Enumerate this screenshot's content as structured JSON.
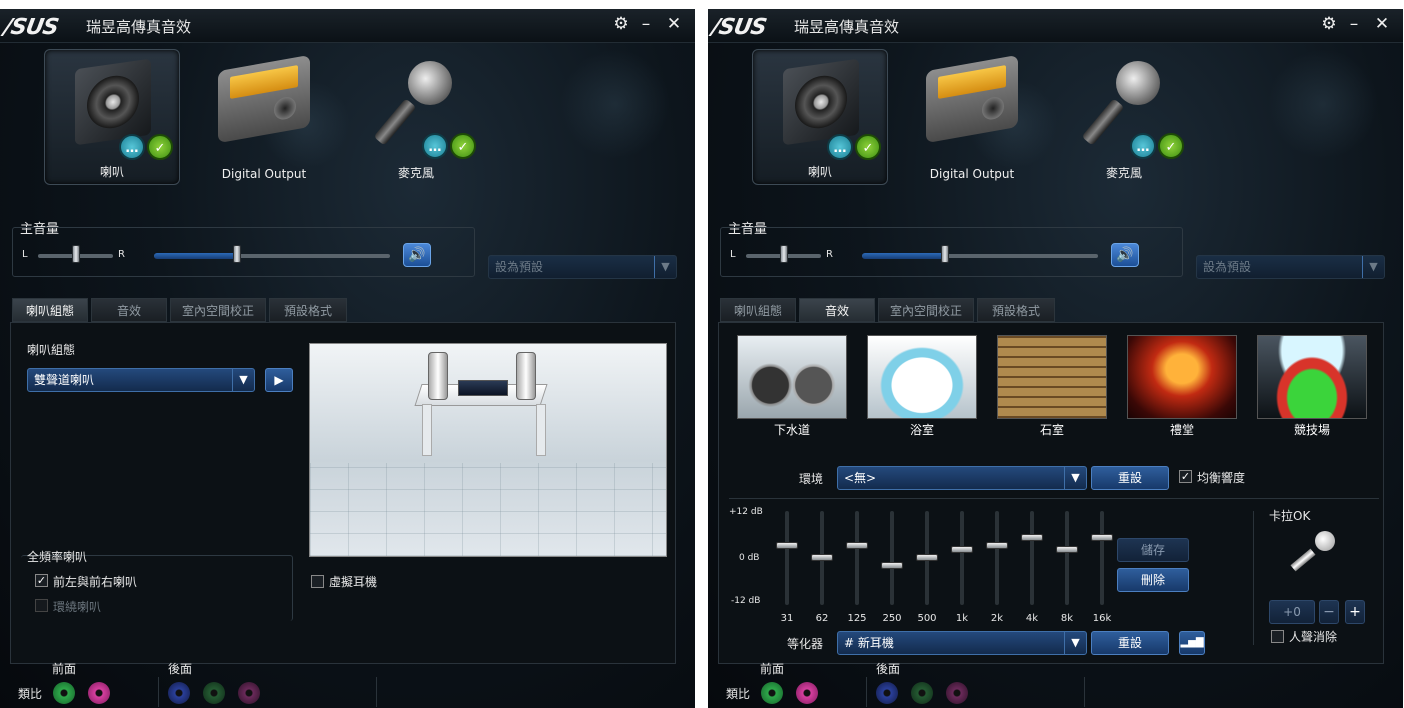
{
  "windows": [
    {
      "brand": "/SUS",
      "title": "瑞昱高傳真音效",
      "devices": [
        {
          "label": "喇叭",
          "icon": "speaker-icon",
          "selected": true
        },
        {
          "label": "Digital Output",
          "icon": "digital-output-icon",
          "selected": false
        },
        {
          "label": "麥克風",
          "icon": "microphone-icon",
          "selected": false
        }
      ],
      "volume": {
        "title": "主音量",
        "left": "L",
        "right": "R",
        "level": 0.35,
        "balance": 0.5
      },
      "default_device": "設為預設",
      "tabs": [
        "喇叭組態",
        "音效",
        "室內空間校正",
        "預設格式"
      ],
      "active_tab": 0,
      "config": {
        "title": "喇叭組態",
        "mode": "雙聲道喇叭",
        "fullrange_title": "全頻率喇叭",
        "front_label": "前左與前右喇叭",
        "front_checked": true,
        "surround_label": "環繞喇叭",
        "virtual_label": "虛擬耳機"
      },
      "jacks": {
        "front": "前面",
        "rear": "後面",
        "analog": "類比"
      }
    },
    {
      "brand": "/SUS",
      "title": "瑞昱高傳真音效",
      "devices": [
        {
          "label": "喇叭",
          "icon": "speaker-icon",
          "selected": true
        },
        {
          "label": "Digital Output",
          "icon": "digital-output-icon",
          "selected": false
        },
        {
          "label": "麥克風",
          "icon": "microphone-icon",
          "selected": false
        }
      ],
      "volume": {
        "title": "主音量",
        "left": "L",
        "right": "R",
        "level": 0.35,
        "balance": 0.5
      },
      "default_device": "設為預設",
      "tabs": [
        "喇叭組態",
        "音效",
        "室內空間校正",
        "預設格式"
      ],
      "active_tab": 1,
      "effects": {
        "presets": [
          "下水道",
          "浴室",
          "石室",
          "禮堂",
          "競技場"
        ],
        "environment_label": "環境",
        "environment_value": "<無>",
        "reset": "重設",
        "loudness_label": "均衡響度",
        "loudness_checked": true,
        "db_labels": [
          "+12 dB",
          "0 dB",
          "-12 dB"
        ],
        "eq_freqs": [
          "31",
          "62",
          "125",
          "250",
          "500",
          "1k",
          "2k",
          "4k",
          "8k",
          "16k"
        ],
        "eq_values": [
          3,
          0,
          3,
          -2,
          0,
          2,
          3,
          5,
          2,
          5
        ],
        "save": "儲存",
        "delete": "刪除",
        "eq_label": "等化器",
        "eq_preset": "# 新耳機",
        "karaoke_title": "卡拉OK",
        "karaoke_value": "+0",
        "karaoke_minus": "−",
        "karaoke_plus": "+",
        "vocal_cancel_label": "人聲消除"
      },
      "jacks": {
        "front": "前面",
        "rear": "後面",
        "analog": "類比"
      }
    }
  ],
  "colors": {
    "jack_green": "#2ea84a",
    "jack_pink": "#d63f9f",
    "jack_blue": "#2a3f9a",
    "accent_blue": "#2c6ab8"
  }
}
